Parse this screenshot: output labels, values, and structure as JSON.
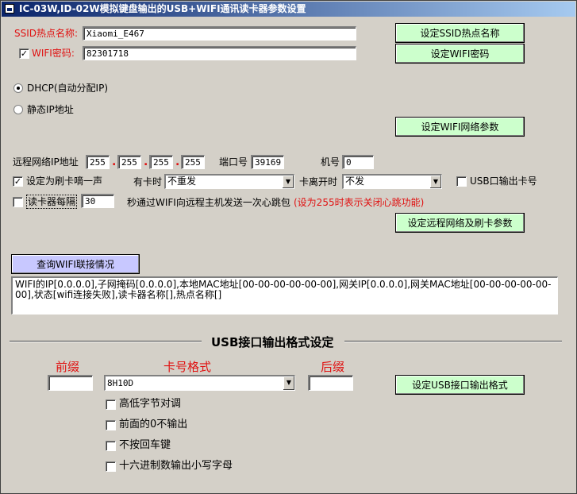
{
  "window": {
    "title": "IC-03W,ID-02W模拟键盘输出的USB+WIFI通讯读卡器参数设置"
  },
  "ssid": {
    "label": "SSID热点名称:",
    "value": "Xiaomi_E467",
    "button": "设定SSID热点名称"
  },
  "wifi_password": {
    "checked": true,
    "label": "WIFI密码:",
    "value": "82301718",
    "button": "设定WIFI密码"
  },
  "ip_mode": {
    "dhcp_label": "DHCP(自动分配IP)",
    "static_label": "静态IP地址",
    "selected": "dhcp",
    "button": "设定WIFI网络参数"
  },
  "remote": {
    "ip_label": "远程网络IP地址",
    "ip": [
      "255",
      "255",
      "255",
      "255"
    ],
    "port_label": "端口号",
    "port": "39169",
    "machine_label": "机号",
    "machine": "0",
    "beep_checked": true,
    "beep_label": "设定为刷卡嘀一声",
    "has_card_label": "有卡时",
    "has_card_value": "不重发",
    "leave_label": "卡离开时",
    "leave_value": "不发",
    "usb_out_checked": false,
    "usb_out_label": "USB口输出卡号",
    "heartbeat_checked": false,
    "heartbeat_label": "读卡器每隔",
    "heartbeat_value": "30",
    "heartbeat_text": "秒通过WIFI向远程主机发送一次心跳包",
    "heartbeat_note": "(设为255时表示关闭心跳功能)",
    "button": "设定远程网络及刷卡参数"
  },
  "query": {
    "button": "查询WIFI联接情况",
    "log": "WIFI的IP[0.0.0.0],子网掩码[0.0.0.0],本地MAC地址[00-00-00-00-00-00],网关IP[0.0.0.0],网关MAC地址[00-00-00-00-00-00],状态[wifi连接失败],读卡器名称[],热点名称[]"
  },
  "usb": {
    "heading": "USB接口输出格式设定",
    "prefix_label": "前缀",
    "format_label": "卡号格式",
    "suffix_label": "后缀",
    "prefix": "",
    "format": "8H10D",
    "suffix": "",
    "button": "设定USB接口输出格式",
    "options": [
      {
        "label": "高低字节对调",
        "checked": false
      },
      {
        "label": "前面的0不输出",
        "checked": false
      },
      {
        "label": "不按回车键",
        "checked": false
      },
      {
        "label": "十六进制数输出小写字母",
        "checked": false
      }
    ]
  }
}
